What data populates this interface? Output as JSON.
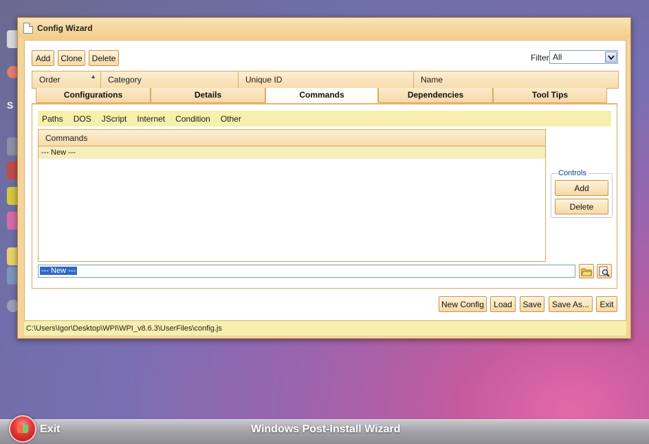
{
  "window": {
    "title": "Config Wizard"
  },
  "toolbar": {
    "add_label": "Add",
    "clone_label": "Clone",
    "delete_label": "Delete",
    "filter_label": "Filter",
    "filter_value": "All"
  },
  "grid": {
    "columns": [
      "Order",
      "Category",
      "Unique ID",
      "Name"
    ]
  },
  "tabs": [
    "Configurations",
    "Details",
    "Commands",
    "Dependencies",
    "Tool Tips"
  ],
  "active_tab": "Commands",
  "subnav": [
    "Paths",
    "DOS",
    "JScript",
    "Internet",
    "Condition",
    "Other"
  ],
  "commands": {
    "header": "Commands",
    "items": [
      "--- New ---"
    ],
    "input_value": "--- New ---"
  },
  "controls": {
    "legend": "Controls",
    "add_label": "Add",
    "delete_label": "Delete"
  },
  "footer_buttons": {
    "new_config": "New Config",
    "load": "Load",
    "save": "Save",
    "save_as": "Save As...",
    "exit": "Exit"
  },
  "status": {
    "path": "C:\\Users\\Igor\\Desktop\\WPI\\WPI_v8.6.3\\UserFiles\\config.js"
  },
  "taskbar": {
    "exit_label": "Exit",
    "title": "Windows Post-Install Wizard"
  },
  "desktop": {
    "left_text_fragment": "S"
  },
  "icons": [
    "document-icon",
    "dropdown-arrow-icon",
    "sort-ascending-icon",
    "folder-open-icon",
    "search-icon",
    "windows-orb-icon"
  ],
  "colors": {
    "window_frame": "#f3d49a",
    "header_gradient_top": "#fdeed3",
    "subnav_bg": "#f7efad",
    "selection": "#316ac5"
  }
}
